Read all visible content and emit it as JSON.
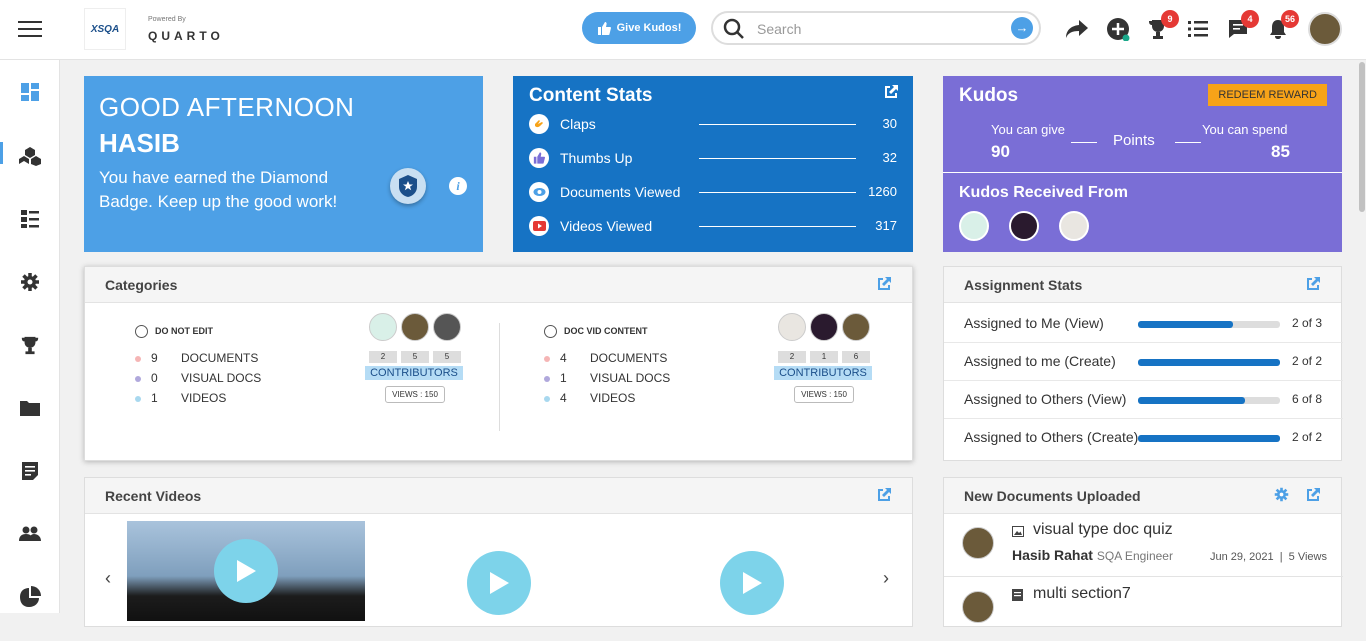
{
  "brand": {
    "logo_text": "XSQA",
    "powered_by": "Powered By",
    "product": "QUARTO"
  },
  "header": {
    "give_kudos_label": "Give Kudos!",
    "search_placeholder": "Search",
    "badges": {
      "trophy": "9",
      "messages": "4",
      "notifications": "56"
    }
  },
  "sidebar": {
    "items": [
      "dashboard-icon",
      "cubes-icon",
      "list-icon",
      "gear-icon",
      "trophy-icon",
      "folder-icon",
      "document-icon",
      "users-icon",
      "pie-chart-icon"
    ],
    "active": "dashboard-icon"
  },
  "greeting": {
    "salutation": "GOOD AFTERNOON",
    "name": "HASIB",
    "message": "You have earned the Diamond Badge. Keep up the good work!"
  },
  "content_stats": {
    "title": "Content Stats",
    "rows": [
      {
        "label": "Claps",
        "value": "30"
      },
      {
        "label": "Thumbs Up",
        "value": "32"
      },
      {
        "label": "Documents Viewed",
        "value": "1260"
      },
      {
        "label": "Videos Viewed",
        "value": "317"
      }
    ]
  },
  "kudos": {
    "title": "Kudos",
    "redeem_label": "REDEEM REWARD",
    "give_label": "You can give",
    "give_value": "90",
    "points_label": "Points",
    "spend_label": "You can spend",
    "spend_value": "85",
    "received_title": "Kudos Received From"
  },
  "categories": {
    "title": "Categories",
    "items": [
      {
        "name": "DO NOT EDIT",
        "documents": "9",
        "visual_docs": "0",
        "videos": "1",
        "contributor_counts": [
          "2",
          "5",
          "5"
        ],
        "contributors_label": "CONTRIBUTORS",
        "views": "VIEWS : 150"
      },
      {
        "name": "DOC VID CONTENT",
        "documents": "4",
        "visual_docs": "1",
        "videos": "4",
        "contributor_counts": [
          "2",
          "1",
          "6"
        ],
        "contributors_label": "CONTRIBUTORS",
        "views": "VIEWS : 150"
      }
    ],
    "labels": {
      "documents": "DOCUMENTS",
      "visual_docs": "VISUAL DOCS",
      "videos": "VIDEOS"
    }
  },
  "assignment_stats": {
    "title": "Assignment Stats",
    "rows": [
      {
        "label": "Assigned to Me (View)",
        "value": "2 of 3",
        "fraction": 0.667
      },
      {
        "label": "Assigned to me (Create)",
        "value": "2 of 2",
        "fraction": 1.0
      },
      {
        "label": "Assigned to Others (View)",
        "value": "6 of 8",
        "fraction": 0.75
      },
      {
        "label": "Assigned to Others (Create)",
        "value": "2 of 2",
        "fraction": 1.0
      }
    ]
  },
  "recent_videos": {
    "title": "Recent Videos"
  },
  "new_documents": {
    "title": "New Documents Uploaded",
    "items": [
      {
        "title": "visual type doc quiz",
        "author": "Hasib Rahat",
        "role": "SQA Engineer",
        "date": "Jun 29, 2021",
        "views": "5 Views"
      },
      {
        "title": "multi section7"
      }
    ]
  },
  "colors": {
    "accent": "#4da0e6",
    "stats_blue": "#1673c4",
    "kudos_purple": "#7a6ed6",
    "redeem_orange": "#f7a318",
    "badge_red": "#e53935"
  }
}
